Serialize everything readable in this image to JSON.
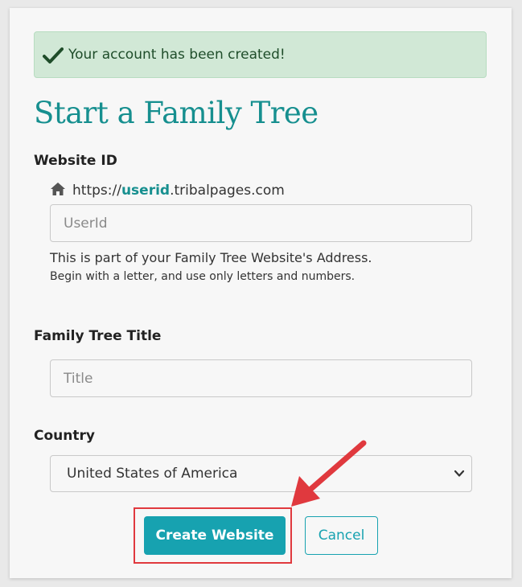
{
  "alert": {
    "message": "Your account has been created!",
    "icon": "checkmark-icon"
  },
  "page_title": "Start a Family Tree",
  "website_id": {
    "label": "Website ID",
    "url_prefix": "https://",
    "url_userid": "userid",
    "url_suffix": ".tribalpages.com",
    "icon": "home-icon",
    "placeholder": "UserId",
    "help_line1": "This is part of your Family Tree Website's Address.",
    "help_line2": "Begin with a letter, and use only letters and numbers."
  },
  "family_tree_title": {
    "label": "Family Tree Title",
    "placeholder": "Title"
  },
  "country": {
    "label": "Country",
    "selected": "United States of America"
  },
  "actions": {
    "create_label": "Create Website",
    "cancel_label": "Cancel"
  },
  "colors": {
    "accent": "#17a2b0",
    "title": "#168f8f",
    "alert_bg": "#d1e8d6",
    "annotation": "#e0393e"
  }
}
